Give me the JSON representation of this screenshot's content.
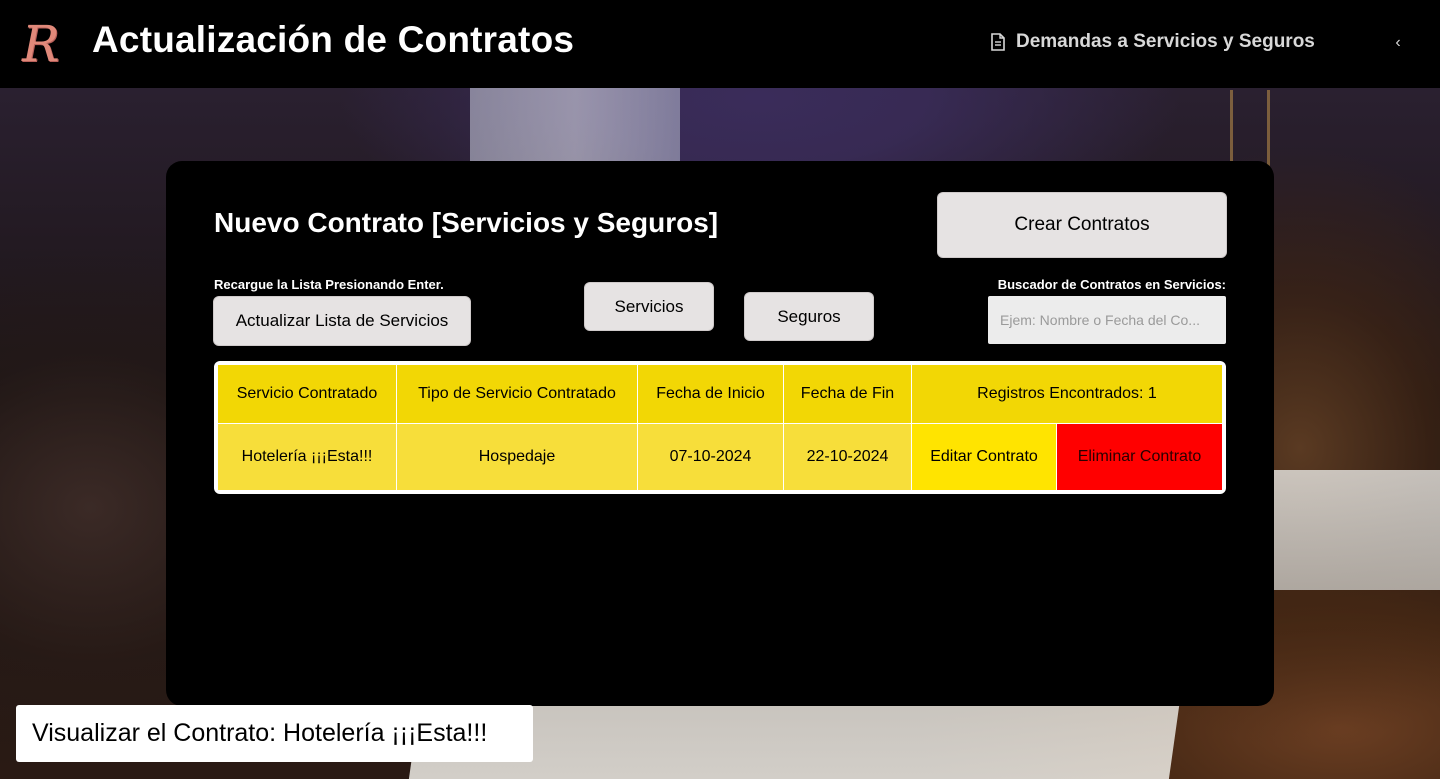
{
  "header": {
    "logo_letter": "R",
    "title": "Actualización de Contratos",
    "nav_link_label": "Demandas a Servicios y Seguros",
    "nav_icon": "document-icon",
    "collapse_icon": "chevron-left-icon",
    "collapse_glyph": "‹"
  },
  "panel": {
    "title": "Nuevo Contrato [Servicios y Seguros]",
    "create_button": "Crear Contratos",
    "reload_hint": "Recargue la Lista Presionando Enter.",
    "refresh_button": "Actualizar Lista de Servicios",
    "servicios_button": "Servicios",
    "seguros_button": "Seguros",
    "search": {
      "label": "Buscador de Contratos en Servicios:",
      "placeholder": "Ejem: Nombre o Fecha del Co...",
      "value": ""
    }
  },
  "table": {
    "headers": [
      "Servicio Contratado",
      "Tipo de Servicio Contratado",
      "Fecha de Inicio",
      "Fecha de Fin",
      "Registros Encontrados: 1"
    ],
    "rows": [
      {
        "servicio": "Hotelería ¡¡¡Esta!!!",
        "tipo": "Hospedaje",
        "inicio": "07-10-2024",
        "fin": "22-10-2024",
        "edit_label": "Editar Contrato",
        "delete_label": "Eliminar Contrato"
      }
    ]
  },
  "preview_label": "Visualizar el Contrato: Hotelería ¡¡¡Esta!!!",
  "colors": {
    "header_bg": "#f2d705",
    "row_bg": "#f7de3a",
    "edit_bg": "#ffe400",
    "delete_bg": "#ff0000",
    "button_bg": "#e6e3e3",
    "logo": "#e0897a"
  }
}
